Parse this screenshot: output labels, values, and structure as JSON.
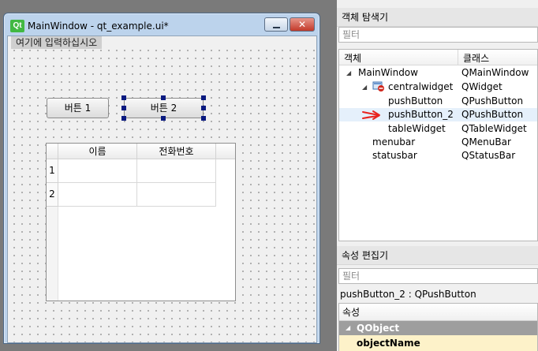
{
  "form_window": {
    "title": "MainWindow - qt_example.ui*",
    "logo_text": "Qt",
    "menu_placeholder": "여기에 입력하십시오",
    "buttons": [
      {
        "label": "버튼 1"
      },
      {
        "label": "버튼 2"
      }
    ],
    "table": {
      "columns": [
        "이름",
        "전화번호"
      ],
      "row_headers": [
        "1",
        "2"
      ]
    }
  },
  "object_inspector": {
    "title": "객체 탐색기",
    "filter_placeholder": "필터",
    "column_object": "객체",
    "column_class": "클래스",
    "rows": [
      {
        "name": "MainWindow",
        "class": "QMainWindow"
      },
      {
        "name": "centralwidget",
        "class": "QWidget"
      },
      {
        "name": "pushButton",
        "class": "QPushButton"
      },
      {
        "name": "pushButton_2",
        "class": "QPushButton"
      },
      {
        "name": "tableWidget",
        "class": "QTableWidget"
      },
      {
        "name": "menubar",
        "class": "QMenuBar"
      },
      {
        "name": "statusbar",
        "class": "QStatusBar"
      }
    ],
    "annotation_color": "#e8231e"
  },
  "property_editor": {
    "title": "속성 편집기",
    "filter_placeholder": "필터",
    "selected": "pushButton_2 : QPushButton",
    "column_property": "속성",
    "group": "QObject",
    "first_property": "objectName"
  }
}
